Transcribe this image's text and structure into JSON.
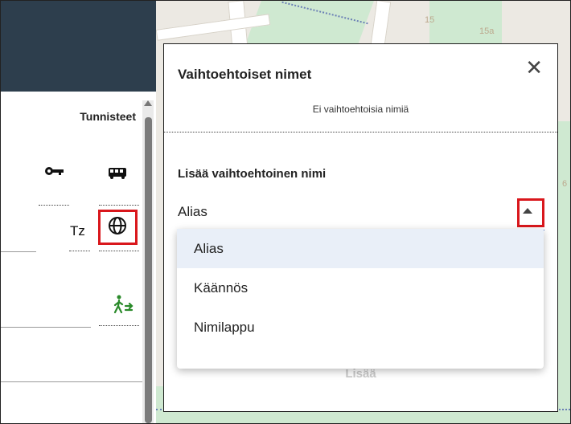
{
  "left_panel": {
    "column_header": "Tunnisteet",
    "tz_label": "Tz",
    "icons": [
      "key-icon",
      "bus-icon",
      "globe-icon",
      "pedestrian-transfer-icon"
    ]
  },
  "map": {
    "labels": [
      "15",
      "15a",
      "6"
    ]
  },
  "dialog": {
    "title": "Vaihtoehtoiset nimet",
    "close_glyph": "✕",
    "empty_text": "Ei vaihtoehtoisia nimiä",
    "subtitle": "Lisää vaihtoehtoinen nimi",
    "selected_value": "Alias",
    "add_button": "Lisää"
  },
  "dropdown": {
    "options": [
      "Alias",
      "Käännös",
      "Nimilappu"
    ],
    "selected_index": 0
  },
  "colors": {
    "header": "#2d3e4d",
    "highlight": "#d9171c",
    "green_icon": "#2a8a2a"
  }
}
